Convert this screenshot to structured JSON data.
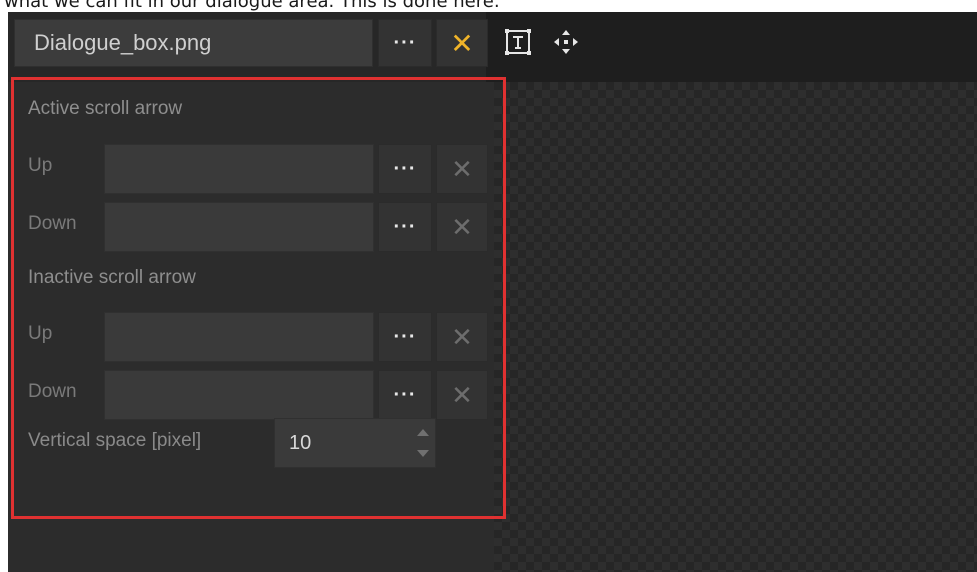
{
  "caption": "what we can fit in our dialogue area. This is done here:",
  "toolbar": {
    "file_name": "Dialogue_box.png",
    "browse_label": "···",
    "clear_icon": "x-icon",
    "text_tool_icon": "text-tool-icon",
    "move_tool_icon": "move-arrows-icon"
  },
  "panel": {
    "active_section": "Active scroll arrow",
    "active_up_label": "Up",
    "active_down_label": "Down",
    "inactive_section": "Inactive scroll arrow",
    "inactive_up_label": "Up",
    "inactive_down_label": "Down",
    "browse_label": "···",
    "vertical_space_label": "Vertical space [pixel]",
    "vertical_space_value": "10"
  },
  "colors": {
    "highlight": "#e03131",
    "clear_accent": "#f0b429",
    "panel_bg": "#2c2c2c"
  }
}
